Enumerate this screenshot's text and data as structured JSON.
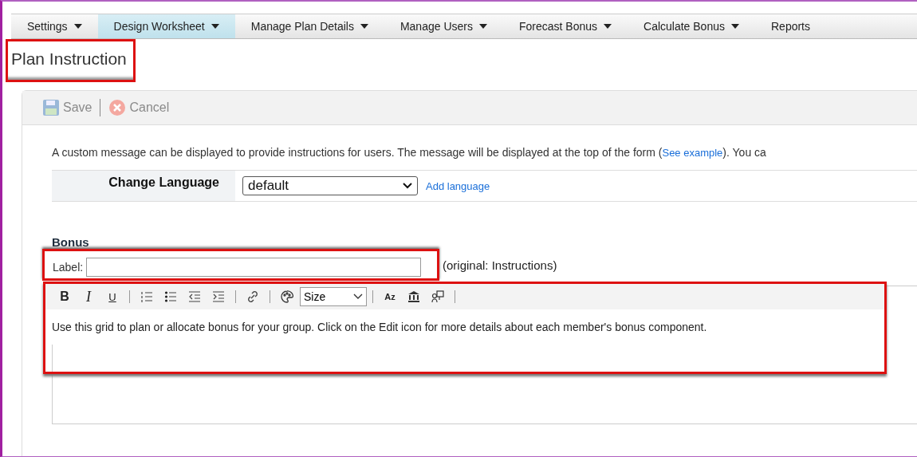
{
  "nav": {
    "tabs": [
      {
        "label": "Settings",
        "selected": false
      },
      {
        "label": "Design Worksheet",
        "selected": true
      },
      {
        "label": "Manage Plan Details",
        "selected": false
      },
      {
        "label": "Manage Users",
        "selected": false
      },
      {
        "label": "Forecast Bonus",
        "selected": false
      },
      {
        "label": "Calculate Bonus",
        "selected": false
      },
      {
        "label": "Reports",
        "selected": false
      }
    ]
  },
  "page_title": {
    "text": "Plan Instruction",
    "highlighted": true
  },
  "toolbar": {
    "buttons": [
      {
        "label": "Save",
        "kind": "save",
        "disabled": true
      },
      {
        "label": "Cancel",
        "kind": "cancel",
        "disabled": true
      }
    ]
  },
  "description": {
    "before": "A custom message can be displayed to provide instructions for users. The message will be displayed at the top of the form (",
    "link": "See example",
    "after": "). You ca"
  },
  "language": {
    "label": "Change Language",
    "value": "default",
    "link": "Add language"
  },
  "section": {
    "title": "Bonus",
    "label": "Label:",
    "hint": "(original: Instructions)",
    "highlighted": true
  },
  "editor": {
    "highlighted": true,
    "tools": [
      {
        "kind": "bold",
        "text": "B"
      },
      {
        "kind": "italic",
        "text": "I"
      },
      {
        "kind": "underline",
        "text": "U"
      },
      {
        "kind": "separator"
      },
      {
        "kind": "numbered-list"
      },
      {
        "kind": "bullet-list"
      },
      {
        "kind": "outdent"
      },
      {
        "kind": "indent"
      },
      {
        "kind": "separator"
      },
      {
        "kind": "link"
      },
      {
        "kind": "separator"
      },
      {
        "kind": "palette"
      },
      {
        "kind": "select",
        "text": "Size"
      },
      {
        "kind": "separator"
      },
      {
        "kind": "sort",
        "text": "Az"
      },
      {
        "kind": "building"
      },
      {
        "kind": "template"
      },
      {
        "kind": "separator"
      }
    ],
    "content": "Use this grid to plan or allocate bonus for your group. Click on the Edit icon for more details about each member's bonus component."
  }
}
